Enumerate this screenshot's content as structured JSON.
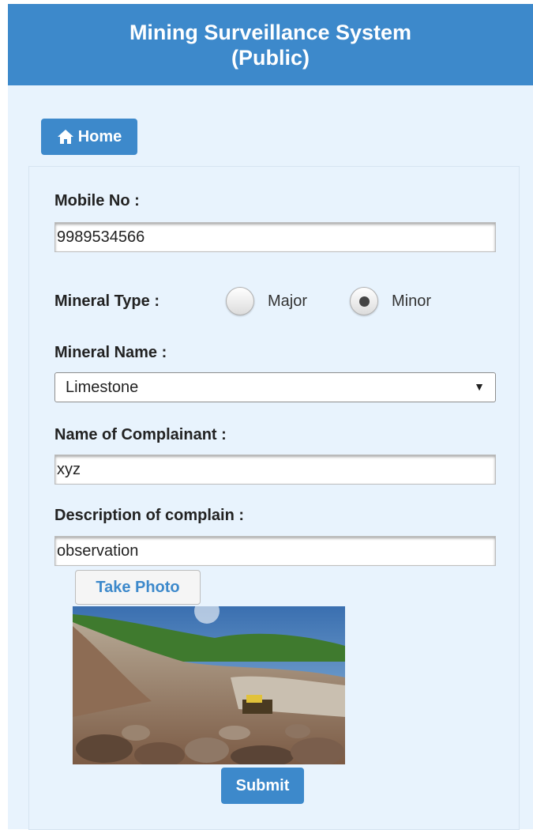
{
  "header": {
    "title_line1": "Mining Surveillance System",
    "title_line2": "(Public)"
  },
  "nav": {
    "home_label": "Home"
  },
  "form": {
    "mobile_label": "Mobile No :",
    "mobile_value": "9989534566",
    "mineral_type_label": "Mineral Type :",
    "mineral_type_options": [
      {
        "label": "Major",
        "selected": false
      },
      {
        "label": "Minor",
        "selected": true
      }
    ],
    "mineral_name_label": "Mineral Name :",
    "mineral_name_value": "Limestone",
    "complainant_label": "Name of Complainant :",
    "complainant_value": "xyz",
    "description_label": "Description of complain :",
    "description_value": "observation",
    "take_photo_label": "Take Photo",
    "submit_label": "Submit"
  },
  "colors": {
    "primary": "#3d89cb",
    "background": "#e8f3fd"
  }
}
